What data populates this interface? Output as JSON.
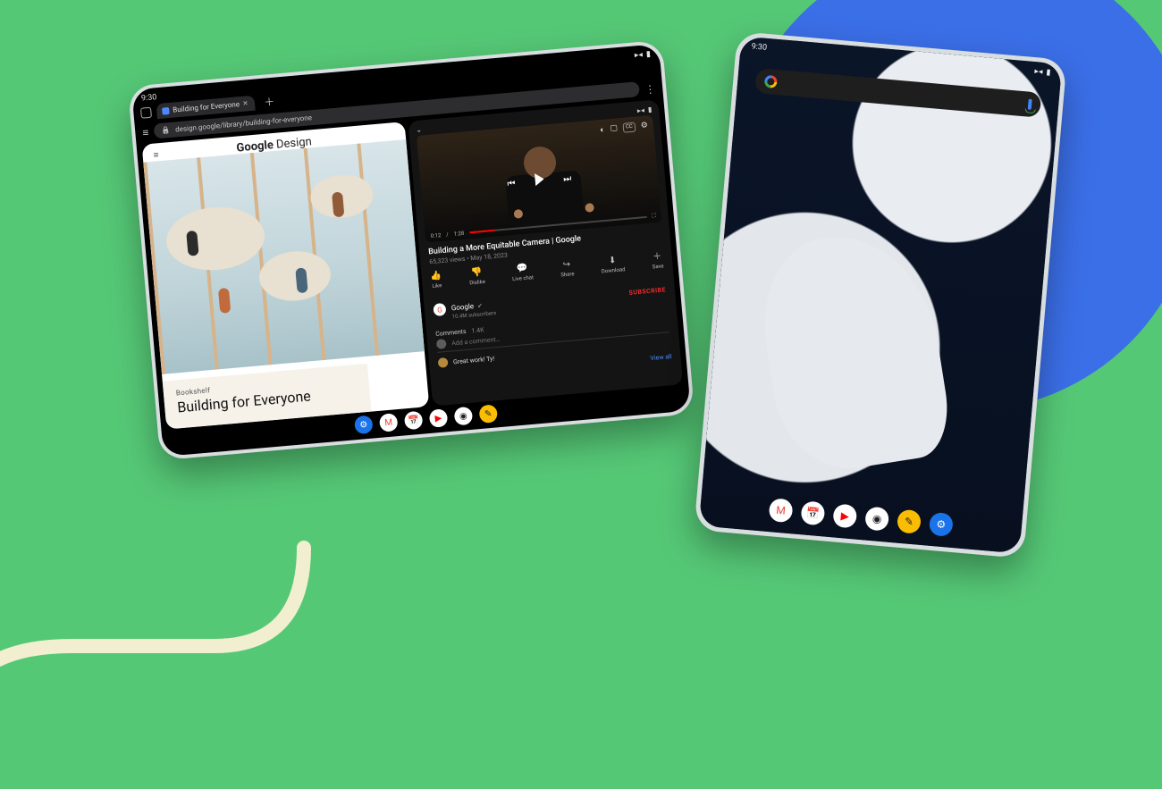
{
  "colors": {
    "bg_green": "#55c876",
    "accent_blue": "#3b6fe8",
    "cream": "#f1efd0",
    "youtube_red": "#ff0000"
  },
  "landscape": {
    "status_time": "9:30",
    "browser": {
      "tab_title": "Building for Everyone",
      "url": "design.google/library/building-for-everyone"
    },
    "left_pane": {
      "site_title_strong": "Google",
      "site_title_light": " Design",
      "kicker": "Bookshelf",
      "headline": "Building for Everyone"
    },
    "right_pane": {
      "time_current": "0:12",
      "time_total": "1:28",
      "progress_pct": 14,
      "title": "Building a More Equitable Camera | Google",
      "meta": "65,323 views • May 18, 2023",
      "actions": [
        {
          "icon": "👍",
          "label": "Like"
        },
        {
          "icon": "👎",
          "label": "Dislike"
        },
        {
          "icon": "💬",
          "label": "Live chat"
        },
        {
          "icon": "↪",
          "label": "Share"
        },
        {
          "icon": "⬇",
          "label": "Download"
        },
        {
          "icon": "＋",
          "label": "Save"
        }
      ],
      "channel_name": "Google",
      "channel_verified": "✔",
      "channel_subs": "10.4M subscribers",
      "subscribe_label": "SUBSCRIBE",
      "comments_label": "Comments",
      "comments_count": "1.4K",
      "comment_placeholder": "Add a comment…",
      "top_comment": "Great work! Ty!",
      "view_all": "View all"
    },
    "dock": [
      {
        "name": "settings",
        "bg": "#1a73e8",
        "glyph": "⚙"
      },
      {
        "name": "gmail",
        "bg": "#ffffff",
        "glyph": "M"
      },
      {
        "name": "calendar",
        "bg": "#ffffff",
        "glyph": "📅"
      },
      {
        "name": "youtube",
        "bg": "#ffffff",
        "glyph": "▶"
      },
      {
        "name": "chrome",
        "bg": "#ffffff",
        "glyph": "◉"
      },
      {
        "name": "keep",
        "bg": "#fbbc04",
        "glyph": "✎"
      }
    ]
  },
  "portrait": {
    "status_time": "9:30",
    "dock": [
      {
        "name": "gmail",
        "bg": "#ffffff",
        "glyph": "M"
      },
      {
        "name": "calendar",
        "bg": "#ffffff",
        "glyph": "📅"
      },
      {
        "name": "youtube",
        "bg": "#ffffff",
        "glyph": "▶"
      },
      {
        "name": "chrome",
        "bg": "#ffffff",
        "glyph": "◉"
      },
      {
        "name": "keep",
        "bg": "#fbbc04",
        "glyph": "✎"
      },
      {
        "name": "settings",
        "bg": "#1a73e8",
        "glyph": "⚙"
      }
    ]
  }
}
